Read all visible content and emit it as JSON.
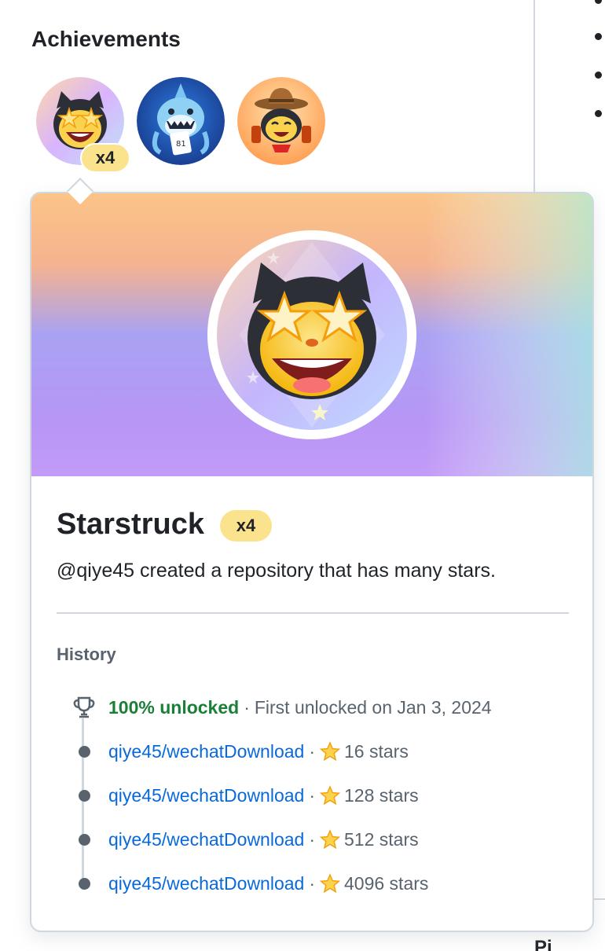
{
  "section": {
    "title": "Achievements"
  },
  "badges": [
    {
      "name": "Starstruck",
      "icon": "starstruck-cat-icon",
      "count_label": "x4"
    },
    {
      "name": "Shark",
      "icon": "shark-icon"
    },
    {
      "name": "Cowboy cat",
      "icon": "cowboy-cat-icon"
    }
  ],
  "popover": {
    "title": "Starstruck",
    "count_label": "x4",
    "description": "@qiye45 created a repository that has many stars.",
    "history_label": "History",
    "unlock": {
      "status": "100% unlocked",
      "separator": "·",
      "detail": "First unlocked on Jan 3, 2024"
    },
    "entries": [
      {
        "repo": "qiye45/wechatDownload",
        "stars": "16 stars"
      },
      {
        "repo": "qiye45/wechatDownload",
        "stars": "128 stars"
      },
      {
        "repo": "qiye45/wechatDownload",
        "stars": "512 stars"
      },
      {
        "repo": "qiye45/wechatDownload",
        "stars": "4096 stars"
      }
    ]
  },
  "footer_fragment": "Pi",
  "colors": {
    "accent_link": "#0969da",
    "success": "#1a7f37",
    "pill": "#fbe38e",
    "border": "#d0d7de",
    "muted": "#59636e"
  }
}
